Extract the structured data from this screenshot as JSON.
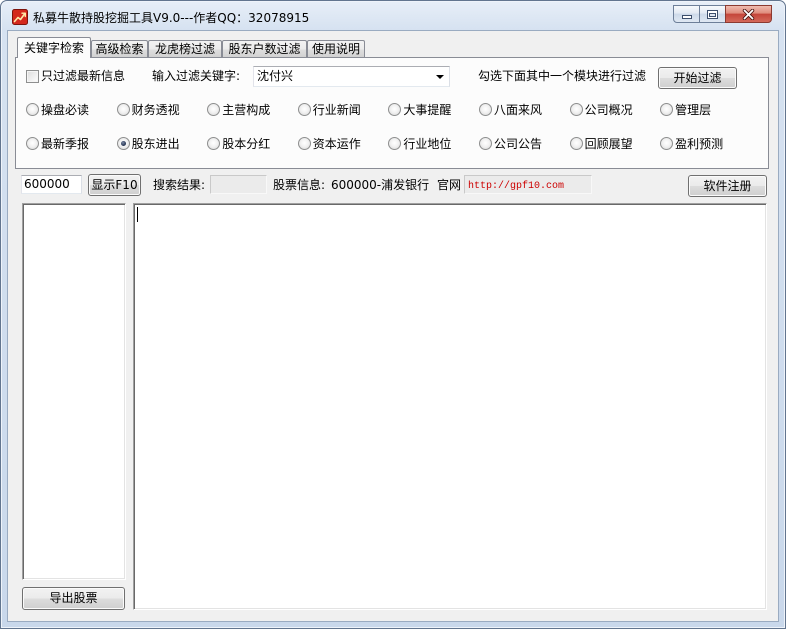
{
  "window": {
    "title": "私募牛散持股挖掘工具V9.0---作者QQ：32078915"
  },
  "icons": {
    "app": "stock-chart-app-icon",
    "minimize": "minimize-icon",
    "maximize": "maximize-icon",
    "close": "close-icon",
    "dropdown": "chevron-down-icon"
  },
  "colors": {
    "frame": "#d6e2f1",
    "client_background": "#f0f0f0",
    "close_button": "#c4453a",
    "website_text": "#cc0000"
  },
  "tabs": [
    {
      "label": "关键字检索",
      "active": true
    },
    {
      "label": "高级检索",
      "active": false
    },
    {
      "label": "龙虎榜过滤",
      "active": false
    },
    {
      "label": "股东户数过滤",
      "active": false
    },
    {
      "label": "使用说明",
      "active": false
    }
  ],
  "filter": {
    "only_latest": {
      "label": "只过滤最新信息",
      "checked": false
    },
    "keyword_label": "输入过滤关键字:",
    "keyword_value": "沈付兴",
    "hint": "勾选下面其中一个模块进行过滤",
    "start_button": "开始过滤"
  },
  "modules": [
    {
      "label": "操盘必读",
      "selected": false
    },
    {
      "label": "财务透视",
      "selected": false
    },
    {
      "label": "主营构成",
      "selected": false
    },
    {
      "label": "行业新闻",
      "selected": false
    },
    {
      "label": "大事提醒",
      "selected": false
    },
    {
      "label": "八面来风",
      "selected": false
    },
    {
      "label": "公司概况",
      "selected": false
    },
    {
      "label": "管理层",
      "selected": false
    },
    {
      "label": "最新季报",
      "selected": false
    },
    {
      "label": "股东进出",
      "selected": true
    },
    {
      "label": "股本分红",
      "selected": false
    },
    {
      "label": "资本运作",
      "selected": false
    },
    {
      "label": "行业地位",
      "selected": false
    },
    {
      "label": "公司公告",
      "selected": false
    },
    {
      "label": "回顾展望",
      "selected": false
    },
    {
      "label": "盈利预测",
      "selected": false
    }
  ],
  "stock_bar": {
    "code_value": "600000",
    "show_f10_button": "显示F10",
    "search_result_label": "搜索结果:",
    "search_result_value": "",
    "stock_info_label": "股票信息:",
    "stock_info_value": "600000-浦发银行",
    "website_label": "官网",
    "website_url": "http://gpf10.com",
    "register_button": "软件注册"
  },
  "result_list": {
    "items": []
  },
  "export_button": "导出股票",
  "editor": {
    "text": ""
  }
}
